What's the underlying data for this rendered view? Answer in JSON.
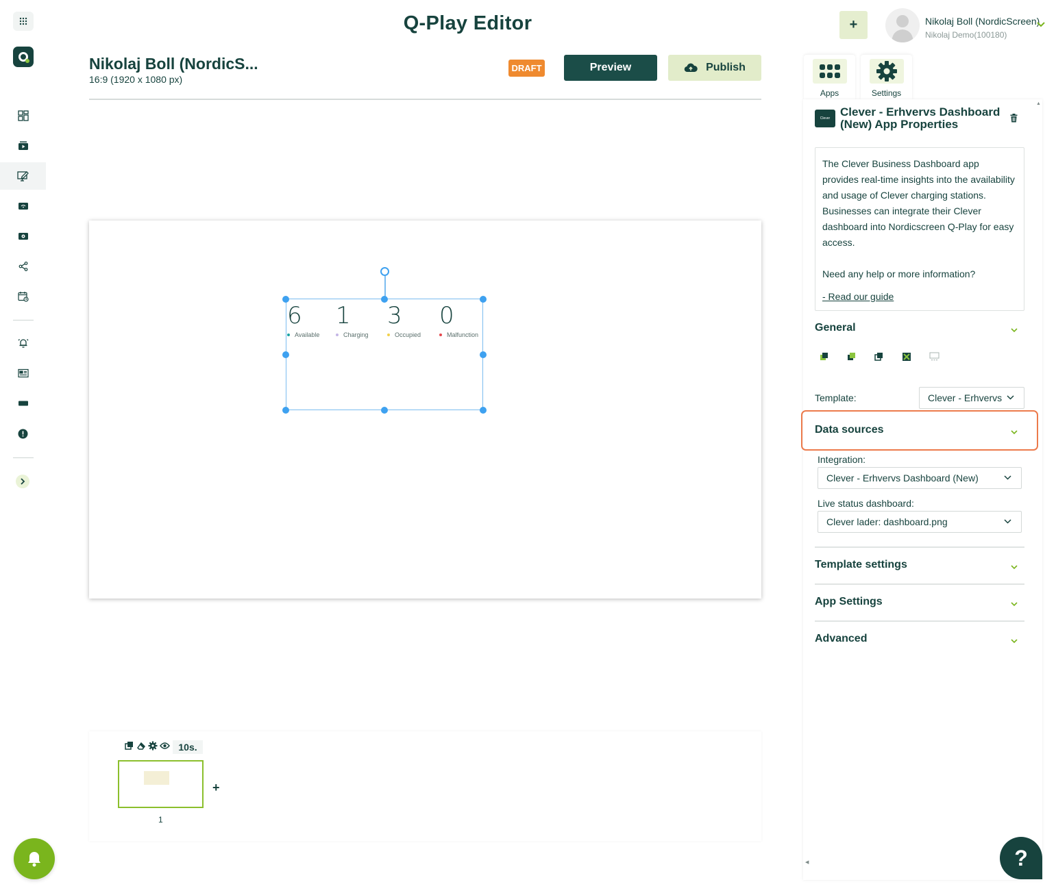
{
  "app": {
    "title": "Q-Play Editor"
  },
  "project": {
    "name": "Nikolaj Boll (NordicS...",
    "resolution": "16:9 (1920 x 1080 px)"
  },
  "header": {
    "draft_label": "DRAFT",
    "preview_label": "Preview",
    "publish_label": "Publish",
    "add_label": "+"
  },
  "user": {
    "name": "Nikolaj Boll (NordicScreen)",
    "org": "Nikolaj Demo(100180)"
  },
  "canvas": {
    "stats": [
      {
        "value": "6",
        "label": "Available",
        "color": "#1aa3a3"
      },
      {
        "value": "1",
        "label": "Charging",
        "color": "#c4b6e6"
      },
      {
        "value": "3",
        "label": "Occupied",
        "color": "#f2d14b"
      },
      {
        "value": "0",
        "label": "Malfunction",
        "color": "#e5484d"
      }
    ]
  },
  "timeline": {
    "duration": "10s.",
    "slide_number": "1",
    "add_label": "+"
  },
  "panel": {
    "tabs": [
      {
        "label": "Apps"
      },
      {
        "label": "Settings"
      }
    ],
    "app_logo_text": "Clever",
    "title": "Clever - Erhvervs Dashboard (New) App Properties",
    "description": "The Clever Business Dashboard app provides real-time insights into the availability and usage of Clever charging stations. Businesses can integrate their Clever dashboard into Nordicscreen Q-Play for easy access.",
    "help_text": "Need any help or more information?",
    "guide_link": "- Read our guide",
    "sections": {
      "general": "General",
      "data_sources": "Data sources",
      "template_settings": "Template settings",
      "app_settings": "App Settings",
      "advanced": "Advanced"
    },
    "template": {
      "label": "Template:",
      "value": "Clever - Erhvervs"
    },
    "integration": {
      "label": "Integration:",
      "value": "Clever - Erhvervs Dashboard (New)"
    },
    "live_status": {
      "label": "Live status dashboard:",
      "value": "Clever lader: dashboard.png"
    }
  },
  "help": {
    "label": "?"
  },
  "colors": {
    "brand": "#17433e",
    "accent": "#7ab51d",
    "draft": "#ef8a2f",
    "highlight": "#ec7a4b"
  }
}
